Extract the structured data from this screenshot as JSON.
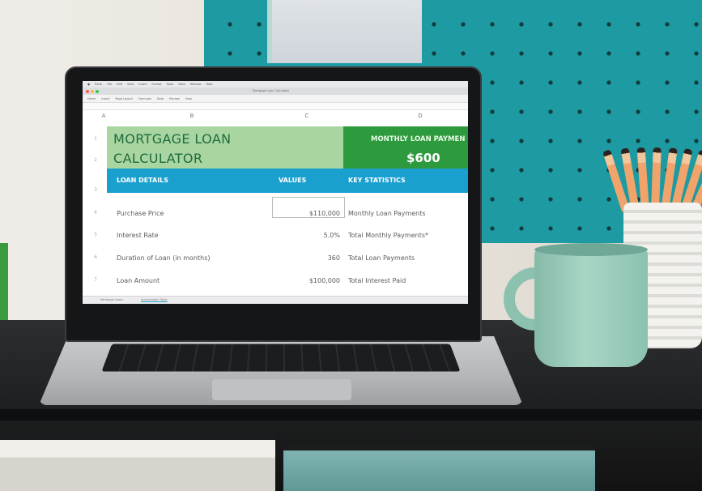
{
  "menubar": [
    "Excel",
    "File",
    "Edit",
    "View",
    "Insert",
    "Format",
    "Tools",
    "Data",
    "Window",
    "Help"
  ],
  "ribbon_tabs": [
    "Home",
    "Insert",
    "Page Layout",
    "Formulas",
    "Data",
    "Review",
    "View"
  ],
  "document_title": "Mortgage Loan Calculator",
  "sheet": {
    "columns": [
      "A",
      "B",
      "C",
      "D"
    ],
    "rows": [
      "1",
      "2",
      "3",
      "4",
      "5",
      "6",
      "7"
    ],
    "title_line1": "MORTGAGE LOAN",
    "title_line2": "CALCULATOR",
    "monthly_payment_label": "MONTHLY LOAN PAYMEN",
    "monthly_payment_value": "$600",
    "headers": {
      "loan_details": "LOAN DETAILS",
      "values": "VALUES",
      "key_statistics": "KEY STATISTICS"
    },
    "loan_rows": [
      {
        "label": "Purchase Price",
        "value": "$110,000",
        "stat": "Monthly Loan Payments"
      },
      {
        "label": "Interest Rate",
        "value": "5.0%",
        "stat": "Total Monthly Payments*"
      },
      {
        "label": "Duration of Loan (in months)",
        "value": "360",
        "stat": "Total Loan Payments"
      },
      {
        "label": "Loan Amount",
        "value": "$100,000",
        "stat": "Total Interest Paid"
      }
    ]
  },
  "tabs": [
    "Mortgage Loans",
    "Amortization Table"
  ],
  "colors": {
    "accent_blue": "#1aa0cf",
    "title_green": "#1f6b3e",
    "light_green": "#a8d5a0",
    "dark_green": "#2e9a3e",
    "pegboard_teal": "#1d9aa2"
  }
}
